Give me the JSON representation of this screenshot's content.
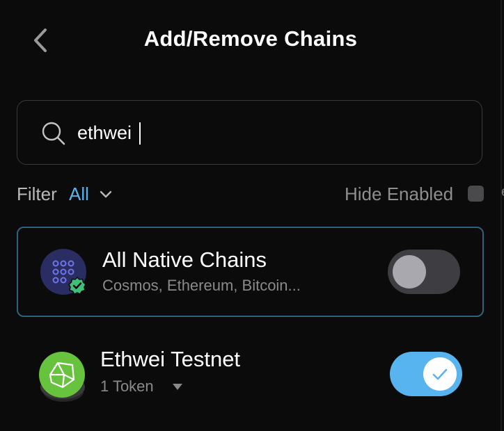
{
  "header": {
    "title": "Add/Remove Chains",
    "back_icon": "chevron-left-icon"
  },
  "search": {
    "value": "ethwei",
    "placeholder": "",
    "icon": "search-icon"
  },
  "filter": {
    "label": "Filter",
    "value": "All",
    "icon": "chevron-down-icon",
    "accent_color": "#58b4ee"
  },
  "hide_enabled": {
    "label": "Hide Enabled",
    "checked": false
  },
  "chains": [
    {
      "name": "All Native Chains",
      "subtitle": "Cosmos, Ethereum, Bitcoin...",
      "icon": "native-chains-logo-icon",
      "badge": "verified-check-icon",
      "enabled": false,
      "selected": true
    },
    {
      "name": "Ethwei Testnet",
      "subtitle": "1 Token",
      "icon": "ethwei-logo-icon",
      "enabled": true,
      "selected": false
    }
  ],
  "colors": {
    "background": "#0b0b0b",
    "accent": "#58b4ee",
    "card_border": "#33607d",
    "toggle_off": "#3e3e42",
    "ethwei_green": "#67c23d",
    "badge_green": "#3fbf7a"
  }
}
